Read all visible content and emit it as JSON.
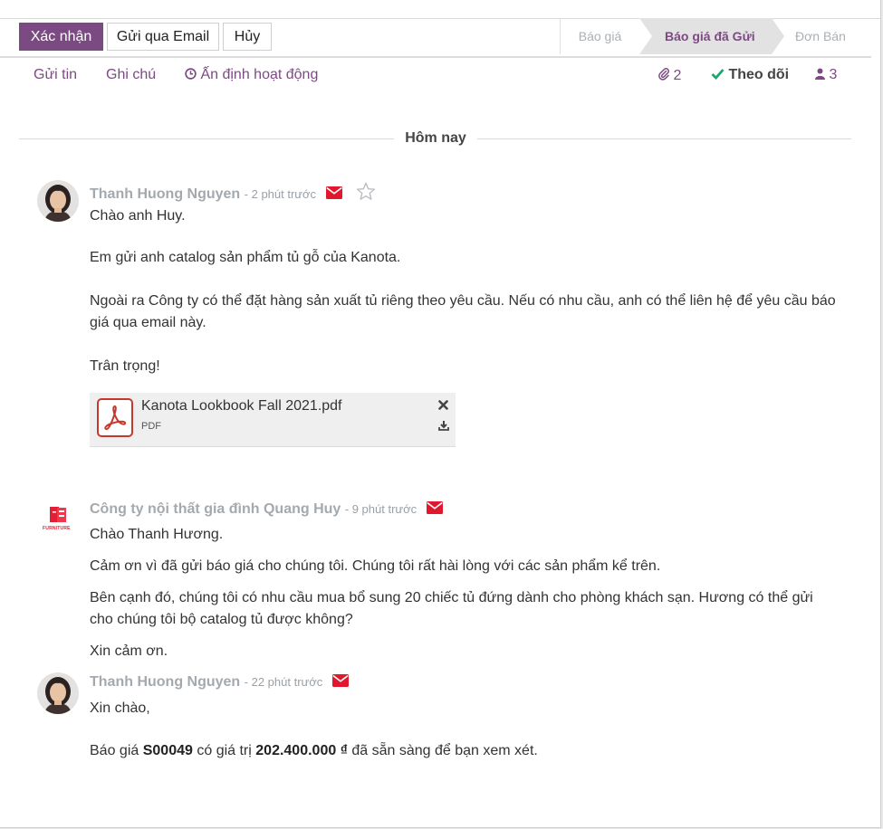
{
  "actions": {
    "confirm": "Xác nhận",
    "send_email": "Gửi qua Email",
    "cancel": "Hủy"
  },
  "stages": [
    "Báo giá",
    "Báo giá đã Gửi",
    "Đơn Bán"
  ],
  "chatter": {
    "send_message": "Gửi tin",
    "log_note": "Ghi chú",
    "schedule_activity": "Ấn định hoạt động",
    "attachments_count": "2",
    "follow": "Theo dõi",
    "followers_count": "3"
  },
  "date_separator": "Hôm nay",
  "messages": [
    {
      "author": "Thanh Huong Nguyen",
      "time": "2 phút trước",
      "lines": [
        "Chào anh Huy.",
        "Em gửi anh catalog sản phẩm tủ gỗ của Kanota.",
        "Ngoài ra Công ty có thể đặt hàng sản xuất tủ riêng theo yêu cầu. Nếu có nhu cầu, anh có thể liên hệ để yêu cầu báo",
        "giá qua email này.",
        "Trân trọng!"
      ],
      "attachment": {
        "name": "Kanota Lookbook Fall 2021.pdf",
        "type": "PDF"
      }
    },
    {
      "author": "Công ty nội thất gia đình Quang Huy",
      "time": "9 phút trước",
      "logo_text": "FURNITURE",
      "lines": [
        "Chào Thanh Hương.",
        "Cảm ơn vì đã gửi báo giá cho chúng tôi. Chúng tôi rất hài lòng với các sản phẩm kể trên.",
        "Bên cạnh đó, chúng tôi có nhu cầu mua bổ sung 20 chiếc tủ đứng dành cho phòng khách sạn. Hương có thể gửi",
        "cho chúng tôi bộ catalog tủ được không?",
        "Xin cảm ơn."
      ]
    },
    {
      "author": "Thanh Huong Nguyen",
      "time": "22 phút trước",
      "greeting": "Xin chào,",
      "quote_prefix": "Báo giá",
      "quote_ref": "S00049",
      "quote_mid": "có giá trị",
      "quote_amount": "202.400.000 ₫",
      "quote_suffix": "đã sẵn sàng để bạn xem xét."
    }
  ],
  "colors": {
    "primary": "#7c4a82",
    "envelope": "#e0182d",
    "check": "#1ea672"
  }
}
